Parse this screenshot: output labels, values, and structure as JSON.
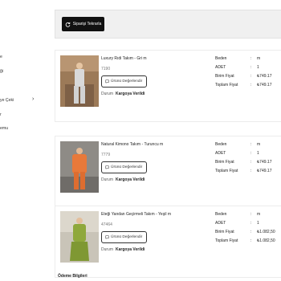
{
  "sidebar": {
    "items": [
      {
        "label": "e"
      },
      {
        "label": "ği"
      },
      {
        "label": "ye Çeki"
      },
      {
        "label": "r"
      },
      {
        "label": "emu"
      }
    ]
  },
  "topbar": {
    "reorder_label": "Siparişi Tekrarla"
  },
  "orders": [
    {
      "name": "Luxury Rıdi Takım - Gri m",
      "code": "7190",
      "rate_label": "Ürünü Değerlendir",
      "status_label": "Durum",
      "status_value": "Kargoya Verildi",
      "attrs": [
        {
          "k": "Beden",
          "v": "m"
        },
        {
          "k": "ADET",
          "v": "1"
        },
        {
          "k": "Birim Fiyat",
          "v": "₺749.17"
        },
        {
          "k": "Toplam Fiyat",
          "v": "₺749.17"
        }
      ]
    },
    {
      "name": "Natural Kimono Takım - Turuncu m",
      "code": "7779",
      "rate_label": "Ürünü Değerlendir",
      "status_label": "Durum",
      "status_value": "Kargoya Verildi",
      "attrs": [
        {
          "k": "Beden",
          "v": "m"
        },
        {
          "k": "ADET",
          "v": "1"
        },
        {
          "k": "Birim Fiyat",
          "v": "₺749.17"
        },
        {
          "k": "Toplam Fiyat",
          "v": "₺749.17"
        }
      ]
    },
    {
      "name": "Eteği Yandan Geçirmeli Takım - Yeşil m",
      "code": "47464",
      "rate_label": "Ürünü Değerlendir",
      "status_label": "Durum",
      "status_value": "Kargoya Verildi",
      "attrs": [
        {
          "k": "Beden",
          "v": "m"
        },
        {
          "k": "ADET",
          "v": "1"
        },
        {
          "k": "Birim Fiyat",
          "v": "₺1.082,50"
        },
        {
          "k": "Toplam Fiyat",
          "v": "₺1.082,50"
        }
      ]
    }
  ],
  "payment": {
    "title": "Ödeme Bilgileri"
  },
  "colors": {
    "button_dark": "#111111",
    "topbar_bg": "#f0f0f0",
    "outfit_gray": "#d8d8d8",
    "outfit_orange": "#e8793a",
    "outfit_green": "#8fa83c"
  }
}
